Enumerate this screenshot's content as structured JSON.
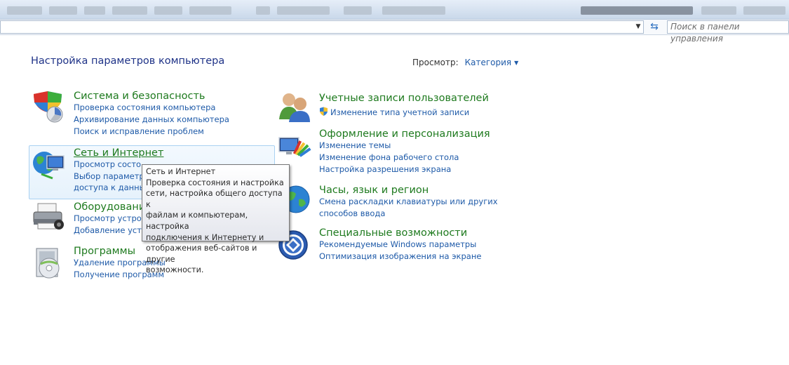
{
  "address": {
    "search_placeholder": "Поиск в панели управления"
  },
  "page": {
    "title": "Настройка параметров компьютера"
  },
  "view": {
    "label": "Просмотр:",
    "value": "Категория"
  },
  "categories": {
    "system": {
      "title": "Система и безопасность",
      "links": [
        "Проверка состояния компьютера",
        "Архивирование данных компьютера",
        "Поиск и исправление проблем"
      ]
    },
    "network": {
      "title": "Сеть и Интернет",
      "links": [
        "Просмотр состо",
        "Выбор параметров",
        "доступа к данным"
      ]
    },
    "hardware": {
      "title": "Оборудовани",
      "links": [
        "Просмотр устрой",
        "Добавление устр"
      ]
    },
    "programs": {
      "title": "Программы",
      "links": [
        "Удаление программы",
        "Получение программ"
      ]
    },
    "accounts": {
      "title": "Учетные записи пользователей",
      "links": [
        "Изменение типа учетной записи"
      ]
    },
    "appearance": {
      "title": "Оформление и персонализация",
      "links": [
        "Изменение темы",
        "Изменение фона рабочего стола",
        "Настройка разрешения экрана"
      ]
    },
    "clock": {
      "title": "Часы, язык и регион",
      "links": [
        "Смена раскладки клавиатуры или других",
        "способов ввода"
      ]
    },
    "access": {
      "title": "Специальные возможности",
      "links": [
        "Рекомендуемые Windows параметры",
        "Оптимизация изображения на экране"
      ]
    }
  },
  "tooltip": {
    "title": "Сеть и Интернет",
    "body": "Проверка состояния и настройка\nсети, настройка общего доступа к\nфайлам и компьютерам, настройка\nподключения к Интернету и\nотображения веб-сайтов и другие\nвозможности."
  },
  "colors": {
    "title_blue": "#1e3287",
    "category_green": "#1e7a1e",
    "link_blue": "#1e5aa8"
  }
}
